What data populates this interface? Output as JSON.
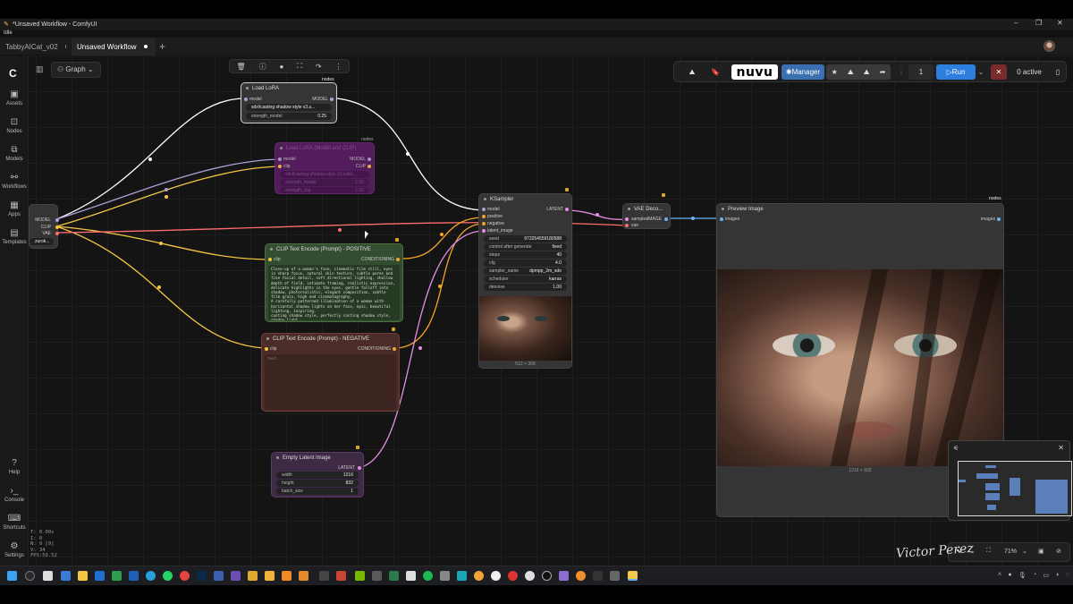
{
  "window": {
    "title": "*Unsaved Workflow - ComfyUI",
    "status": "Idle",
    "minimize_glyph": "–",
    "maximize_glyph": "❐",
    "close_glyph": "✕"
  },
  "tabs": [
    {
      "label": "TabbyAICat_v02",
      "active": false
    },
    {
      "label": "Unsaved Workflow",
      "active": true
    }
  ],
  "new_tab_glyph": "+",
  "sidebar": {
    "logo": "C",
    "items": [
      {
        "label": "Assets",
        "icon": "image-icon"
      },
      {
        "label": "Nodes",
        "icon": "node-icon"
      },
      {
        "label": "Models",
        "icon": "cube-icon"
      },
      {
        "label": "Workflows",
        "icon": "workflow-icon"
      },
      {
        "label": "Apps",
        "icon": "apps-icon"
      },
      {
        "label": "Templates",
        "icon": "templates-icon"
      },
      {
        "label": "Help",
        "icon": "help-icon"
      },
      {
        "label": "Console",
        "icon": "terminal-icon"
      },
      {
        "label": "Shortcuts",
        "icon": "keyboard-icon"
      },
      {
        "label": "Settings",
        "icon": "gear-icon"
      }
    ]
  },
  "graph_button": {
    "label": "Graph"
  },
  "status_lines": [
    "T: 0.00s",
    "I: 0",
    "N: 9 [9]",
    "V: 34",
    "FPS:59.52"
  ],
  "right_toolbar": {
    "brand": "nuvu",
    "manager_label": "Manager",
    "run_count": "1",
    "run_label": "Run",
    "active_label": "0 active"
  },
  "nodes": {
    "load_lora": {
      "title": "Load LoRA",
      "tag": "nodes",
      "input": "model",
      "output": "MODEL",
      "lora_value": "sdxl\\casting shadow style v3.s...",
      "strength_label": "strength_model",
      "strength_value": "0.25"
    },
    "lora_bypassed": {
      "title": "Load LoRA (Model and CLIP)",
      "tag": "nodes",
      "in_model": "model",
      "in_clip": "clip",
      "out_model": "MODEL",
      "out_clip": "CLIP",
      "w1": "sdxl\\casting shadow style v3.safet...",
      "w2_label": "strength_model",
      "w2_value": "1.00",
      "w3_label": "strength_clip",
      "w3_value": "1.00"
    },
    "checkpoint": {
      "out_model": "MODEL",
      "out_clip": "CLIP",
      "out_vae": "VAE",
      "value": "zurok..."
    },
    "positive": {
      "title": "CLIP Text Encode (Prompt) - POSITIVE",
      "input": "clip",
      "output": "CONDITIONING",
      "text": "Close-up of a woman's face, cinematic film still, eyes in sharp focus, natural skin texture, subtle pores and fine facial detail, soft directional lighting, shallow depth of field, intimate framing, realistic expression, delicate highlights in the eyes, gentle falloff into shadow, photorealistic, elegant composition, subtle film grain, high end cinematography.\nA carefully patterned illumination of a woman with horizontal shadow lights on her face, epic, beautiful lighting, inspiring.\ncasting shadow style, perfectly casting shadow style, shadow light"
    },
    "negative": {
      "title": "CLIP Text Encode (Prompt) - NEGATIVE",
      "input": "clip",
      "output": "CONDITIONING",
      "placeholder": "text"
    },
    "ksampler": {
      "title": "KSampler",
      "inputs": [
        "model",
        "positive",
        "negative",
        "latent_image"
      ],
      "output": "LATENT",
      "widgets": [
        {
          "label": "seed",
          "value": "973254559180588"
        },
        {
          "label": "control after generate",
          "value": "fixed"
        },
        {
          "label": "steps",
          "value": "40"
        },
        {
          "label": "cfg",
          "value": "4.0"
        },
        {
          "label": "sampler_name",
          "value": "dpmpp_2m_sde"
        },
        {
          "label": "scheduler",
          "value": "karras"
        },
        {
          "label": "denoise",
          "value": "1.00"
        }
      ],
      "preview_caption": "512 × 368"
    },
    "vae_decode": {
      "title": "VAE Deco...",
      "in_samples": "samples",
      "in_vae": "vae",
      "output": "IMAGE"
    },
    "preview": {
      "title": "Preview Image",
      "tag": "nodes",
      "input": "images",
      "output": "images",
      "caption": "1216 × 832"
    },
    "empty_latent": {
      "title": "Empty Latent Image",
      "output": "LATENT",
      "widgets": [
        {
          "label": "width",
          "value": "1216"
        },
        {
          "label": "height",
          "value": "832"
        },
        {
          "label": "batch_size",
          "value": "1"
        }
      ]
    }
  },
  "bottom_controls": {
    "zoom": "71%"
  },
  "link_colors": {
    "model": "#b39ddb",
    "clip": "#f5c542",
    "vae": "#ff6e6e",
    "conditioning": "#f5a623",
    "latent": "#e58ee8",
    "image": "#64b5f6"
  },
  "signature": "Victor Perez"
}
